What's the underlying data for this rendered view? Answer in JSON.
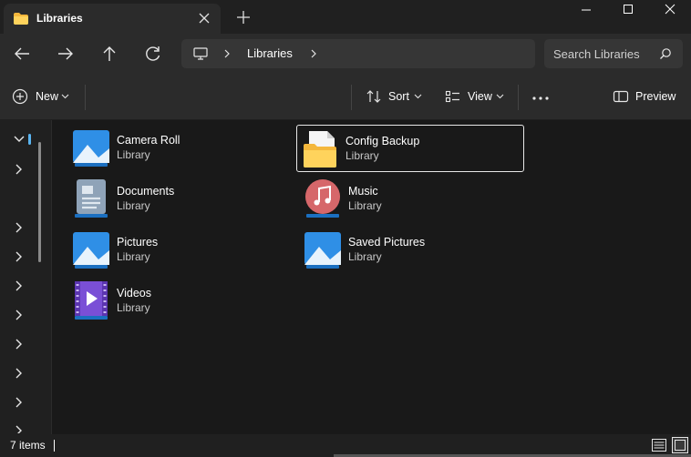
{
  "window": {
    "tab_title": "Libraries",
    "icons": {
      "tab": "folder-icon",
      "close_tab": "close-icon",
      "new_tab": "plus-icon",
      "minimize": "minimize-icon",
      "maximize": "maximize-icon",
      "close": "close-icon"
    }
  },
  "address_bar": {
    "breadcrumb": [
      "Libraries"
    ],
    "search_placeholder": "Search Libraries",
    "icons": {
      "back": "arrow-left-icon",
      "forward": "arrow-right-icon",
      "up": "arrow-up-icon",
      "refresh": "refresh-icon",
      "location": "computer-icon",
      "search": "search-icon"
    }
  },
  "toolbar": {
    "new_label": "New",
    "sort_label": "Sort",
    "view_label": "View",
    "preview_label": "Preview",
    "icons": [
      "plus-circle-icon",
      "cut-icon",
      "copy-icon",
      "paste-icon",
      "rename-icon",
      "share-icon",
      "delete-icon",
      "sort-icon",
      "view-icon",
      "more-icon",
      "preview-pane-icon"
    ]
  },
  "libraries": [
    {
      "name": "Camera Roll",
      "type": "Library",
      "icon": "pictures-library-icon"
    },
    {
      "name": "Config Backup",
      "type": "Library",
      "icon": "folder-document-icon",
      "selected": true
    },
    {
      "name": "Documents",
      "type": "Library",
      "icon": "documents-library-icon"
    },
    {
      "name": "Music",
      "type": "Library",
      "icon": "music-library-icon"
    },
    {
      "name": "Pictures",
      "type": "Library",
      "icon": "pictures-library-icon"
    },
    {
      "name": "Saved Pictures",
      "type": "Library",
      "icon": "pictures-library-icon"
    },
    {
      "name": "Videos",
      "type": "Library",
      "icon": "videos-library-icon"
    }
  ],
  "status_bar": {
    "item_count": "7 items",
    "icons": [
      "details-view-icon",
      "tiles-view-icon"
    ]
  },
  "colors": {
    "background": "#191919",
    "panel": "#2b2b2b",
    "accent": "#5ab4f0",
    "folder": "#f9c74f"
  }
}
